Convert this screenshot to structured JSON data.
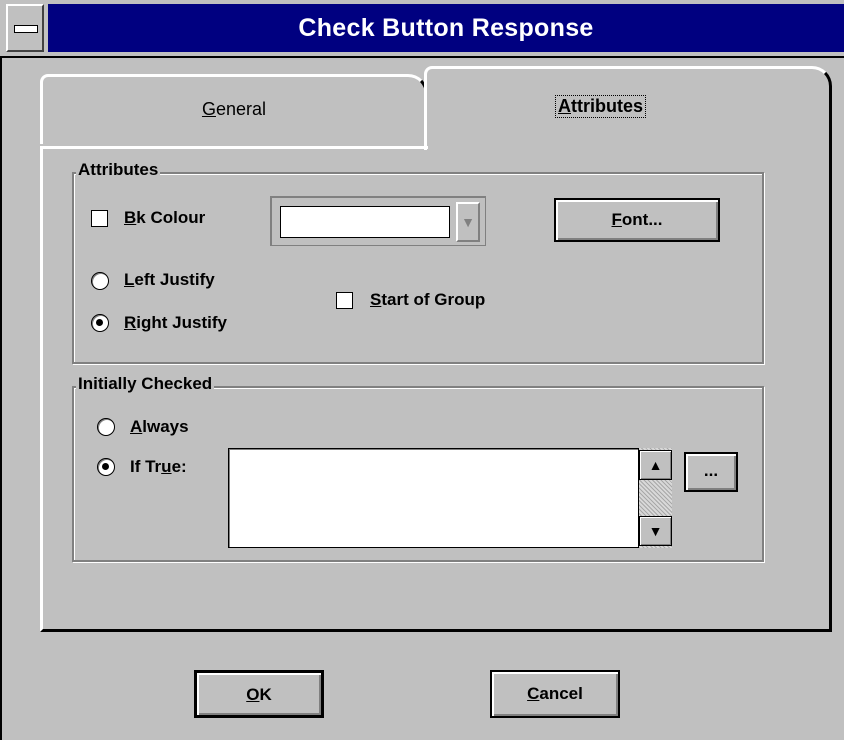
{
  "window": {
    "title": "Check Button Response"
  },
  "tabs": [
    {
      "label": "General",
      "underline_index": 0,
      "selected": false
    },
    {
      "label": "Attributes",
      "underline_index": 0,
      "selected": true
    }
  ],
  "attributes_group": {
    "title": "Attributes",
    "bk_colour": {
      "label_first": "B",
      "label_rest": "k Colour",
      "checked": false
    },
    "combo_value": "",
    "font_button": {
      "label_first": "F",
      "label_rest": "ont..."
    },
    "left_justify": {
      "label_first": "L",
      "label_rest": "eft Justify",
      "selected": false
    },
    "right_justify": {
      "label_first": "R",
      "label_rest": "ight Justify",
      "selected": true
    },
    "start_of_group": {
      "label_first": "S",
      "label_rest": "tart of Group",
      "checked": false
    }
  },
  "initially_checked_group": {
    "title": "Initially Checked",
    "always": {
      "label_first": "A",
      "label_rest": "lways",
      "selected": false
    },
    "if_true": {
      "label_pre": "If Tr",
      "label_u": "u",
      "label_post": "e:",
      "selected": true
    },
    "expression_value": "",
    "ellipsis_button": "..."
  },
  "buttons": {
    "ok": {
      "label_first": "O",
      "label_rest": "K"
    },
    "cancel": {
      "label_first": "C",
      "label_rest": "ancel"
    }
  },
  "icons": {
    "system_menu": "system-menu-icon",
    "scroll_up": "▲",
    "scroll_down": "▼",
    "combo_down": "▼"
  }
}
